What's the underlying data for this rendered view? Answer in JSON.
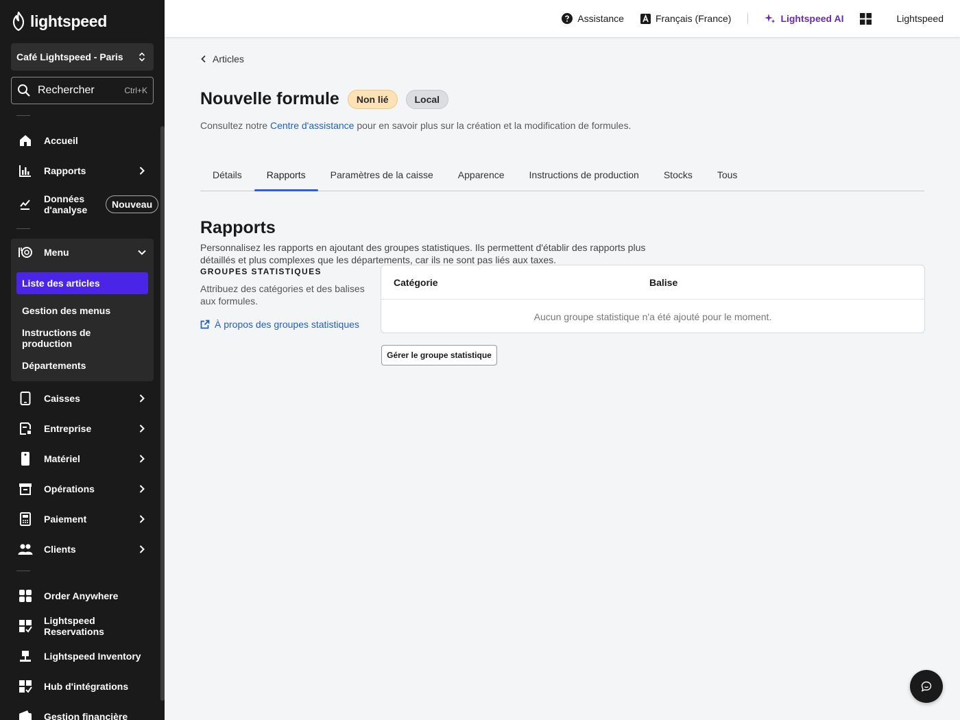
{
  "brand": {
    "name": "lightspeed"
  },
  "sidebar": {
    "store_name": "Café Lightspeed - Paris",
    "search_label": "Rechercher",
    "search_shortcut": "Ctrl+K",
    "items": {
      "accueil": "Accueil",
      "rapports": "Rapports",
      "donnees_line1": "Données",
      "donnees_line2": "d'analyse",
      "nouveau_badge": "Nouveau",
      "menu": "Menu",
      "liste_articles": "Liste des articles",
      "gestion_menus": "Gestion des menus",
      "instructions_production": "Instructions de production",
      "departements": "Départements",
      "caisses": "Caisses",
      "entreprise": "Entreprise",
      "materiel": "Matériel",
      "operations": "Opérations",
      "paiement": "Paiement",
      "clients": "Clients",
      "order_anywhere": "Order Anywhere",
      "reservations": "Lightspeed Reservations",
      "inventory": "Lightspeed Inventory",
      "hub": "Hub d'intégrations",
      "gestion_financiere": "Gestion financière"
    }
  },
  "topbar": {
    "assistance": "Assistance",
    "language": "Français (France)",
    "ai": "Lightspeed AI",
    "account": "Lightspeed"
  },
  "main": {
    "breadcrumb": "Articles",
    "title": "Nouvelle formule",
    "badge_unlinked": "Non lié",
    "badge_local": "Local",
    "help_prefix": "Consultez notre ",
    "help_link": "Centre d'assistance",
    "help_suffix": " pour en savoir plus sur la création et la modification de formules.",
    "tabs": [
      "Détails",
      "Rapports",
      "Paramètres de la caisse",
      "Apparence",
      "Instructions de production",
      "Stocks",
      "Tous"
    ],
    "active_tab": "Rapports",
    "section_title": "Rapports",
    "section_desc": "Personnalisez les rapports en ajoutant des groupes statistiques. Ils permettent d'établir des rapports plus détaillés et plus complexes que les départements, car ils ne sont pas liés aux taxes.",
    "group_heading": "GROUPES STATISTIQUES",
    "group_desc": "Attribuez des catégories et des balises aux formules.",
    "group_link": "À propos des groupes statistiques",
    "table": {
      "col_category": "Catégorie",
      "col_tag": "Balise",
      "empty_text": "Aucun groupe statistique n'a été ajouté pour le moment."
    },
    "manage_button": "Gérer le groupe statistique"
  },
  "colors": {
    "sidebar_bg": "#1a1a1a",
    "active_nav": "#4a25e8",
    "link": "#1f5fc4",
    "ai_purple": "#6b2aa8",
    "tab_underline": "#2d5fd8"
  }
}
